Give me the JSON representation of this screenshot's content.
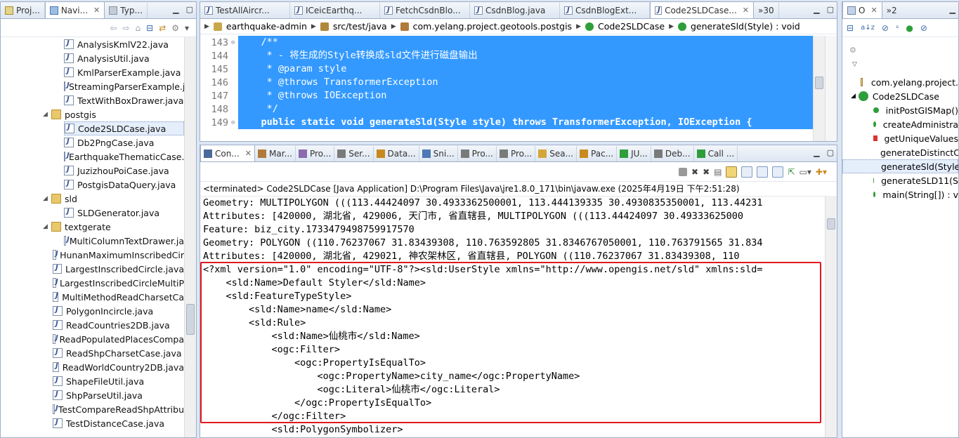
{
  "left_panel": {
    "tabs": [
      "Proj...",
      "Navi...",
      "Typ..."
    ],
    "tree": [
      {
        "label": "AnalysisKmlV22.java",
        "type": "file",
        "indent": 1
      },
      {
        "label": "AnalysisUtil.java",
        "type": "file",
        "indent": 1
      },
      {
        "label": "KmlParserExample.java",
        "type": "file",
        "indent": 1
      },
      {
        "label": "StreamingParserExample.j",
        "type": "file",
        "indent": 1
      },
      {
        "label": "TextWithBoxDrawer.java",
        "type": "file",
        "indent": 1
      },
      {
        "label": "postgis",
        "type": "folder",
        "indent": 0
      },
      {
        "label": "Code2SLDCase.java",
        "type": "file",
        "indent": 1,
        "selected": true
      },
      {
        "label": "Db2PngCase.java",
        "type": "file",
        "indent": 1
      },
      {
        "label": "EarthquakeThematicCase.j",
        "type": "file",
        "indent": 1
      },
      {
        "label": "JuzizhouPoiCase.java",
        "type": "file",
        "indent": 1
      },
      {
        "label": "PostgisDataQuery.java",
        "type": "file",
        "indent": 1
      },
      {
        "label": "sld",
        "type": "folder",
        "indent": 0
      },
      {
        "label": "SLDGenerator.java",
        "type": "file",
        "indent": 1
      },
      {
        "label": "textgerate",
        "type": "folder",
        "indent": 0
      },
      {
        "label": "MultiColumnTextDrawer.ja",
        "type": "file",
        "indent": 1
      },
      {
        "label": "HunanMaximumInscribedCir",
        "type": "file",
        "indent": 0
      },
      {
        "label": "LargestInscribedCircle.java",
        "type": "file",
        "indent": 0
      },
      {
        "label": "LargestInscribedCircleMultiP",
        "type": "file",
        "indent": 0
      },
      {
        "label": "MultiMethodReadCharsetCa",
        "type": "file",
        "indent": 0
      },
      {
        "label": "PolygonIncircle.java",
        "type": "file",
        "indent": 0
      },
      {
        "label": "ReadCountries2DB.java",
        "type": "file",
        "indent": 0
      },
      {
        "label": "ReadPopulatedPlacesCompa",
        "type": "file",
        "indent": 0
      },
      {
        "label": "ReadShpCharsetCase.java",
        "type": "file",
        "indent": 0
      },
      {
        "label": "ReadWorldCountry2DB.java",
        "type": "file",
        "indent": 0
      },
      {
        "label": "ShapeFileUtil.java",
        "type": "file",
        "indent": 0
      },
      {
        "label": "ShpParseUtil.java",
        "type": "file",
        "indent": 0
      },
      {
        "label": "TestCompareReadShpAttribu",
        "type": "file",
        "indent": 0
      },
      {
        "label": "TestDistanceCase.java",
        "type": "file",
        "indent": 0
      }
    ]
  },
  "editor": {
    "tabs": [
      "TestAllAircr...",
      "ICeicEarthq...",
      "FetchCsdnBlo...",
      "CsdnBlog.java",
      "CsdnBlogExt...",
      "Code2SLDCase..."
    ],
    "overflow_tabs": "»30",
    "breadcrumb": [
      "earthquake-admin",
      "src/test/java",
      "com.yelang.project.geotools.postgis",
      "Code2SLDCase",
      "generateSld(Style) : void"
    ],
    "lines": [
      {
        "num": "143",
        "text": "    /**"
      },
      {
        "num": "144",
        "text": "     * - 将生成的Style转换成sld文件进行磁盘输出"
      },
      {
        "num": "145",
        "text": "     * @param style"
      },
      {
        "num": "146",
        "text": "     * @throws TransformerException"
      },
      {
        "num": "147",
        "text": "     * @throws IOException"
      },
      {
        "num": "148",
        "text": "     */"
      },
      {
        "num": "149",
        "text": "    public static void generateSld(Style style) throws TransformerException, IOException {"
      }
    ]
  },
  "console": {
    "tabs": [
      "Con...",
      "Mar...",
      "Pro...",
      "Ser...",
      "Data...",
      "Sni...",
      "Pro...",
      "Pro...",
      "Sea...",
      "Pac...",
      "JU...",
      "Deb...",
      "Call ..."
    ],
    "status": "<terminated> Code2SLDCase [Java Application] D:\\Program Files\\Java\\jre1.8.0_171\\bin\\javaw.exe (2025年4月19日 下午2:51:28)",
    "lines": [
      "Geometry: MULTIPOLYGON (((113.44424097 30.4933362500001, 113.444139335 30.4930835350001, 113.44231",
      "Attributes: [420000, 湖北省, 429006, 天门市, 省直辖县, MULTIPOLYGON (((113.44424097 30.49333625000",
      "Feature: biz_city.1733479498759917570",
      "Geometry: POLYGON ((110.76237067 31.83439308, 110.763592805 31.8346767050001, 110.763791565 31.834",
      "Attributes: [420000, 湖北省, 429021, 神农架林区, 省直辖县, POLYGON ((110.76237067 31.83439308, 110",
      "<?xml version=\"1.0\" encoding=\"UTF-8\"?><sld:UserStyle xmlns=\"http://www.opengis.net/sld\" xmlns:sld=",
      "    <sld:Name>Default Styler</sld:Name>",
      "    <sld:FeatureTypeStyle>",
      "        <sld:Name>name</sld:Name>",
      "        <sld:Rule>",
      "            <sld:Name>仙桃市</sld:Name>",
      "            <ogc:Filter>",
      "                <ogc:PropertyIsEqualTo>",
      "                    <ogc:PropertyName>city_name</ogc:PropertyName>",
      "                    <ogc:Literal>仙桃市</ogc:Literal>",
      "                </ogc:PropertyIsEqualTo>",
      "            </ogc:Filter>",
      "            <sld:PolygonSymbolizer>"
    ]
  },
  "outline": {
    "tabs": [
      "O",
      "»2"
    ],
    "items": [
      {
        "label": "com.yelang.project.",
        "kind": "package"
      },
      {
        "label": "Code2SLDCase",
        "kind": "class"
      },
      {
        "label": "initPostGISMap()",
        "kind": "public"
      },
      {
        "label": "createAdministra",
        "kind": "public"
      },
      {
        "label": "getUniqueValues",
        "kind": "private"
      },
      {
        "label": "generateDistinctC",
        "kind": "private"
      },
      {
        "label": "generateSld(Style",
        "kind": "public",
        "selected": true
      },
      {
        "label": "generateSLD11(S",
        "kind": "public"
      },
      {
        "label": "main(String[]) : v",
        "kind": "public"
      }
    ]
  },
  "colors": {
    "selection": "#3399ff",
    "highlight_box": "#e0191e",
    "panel_border": "#a0b0c8"
  }
}
